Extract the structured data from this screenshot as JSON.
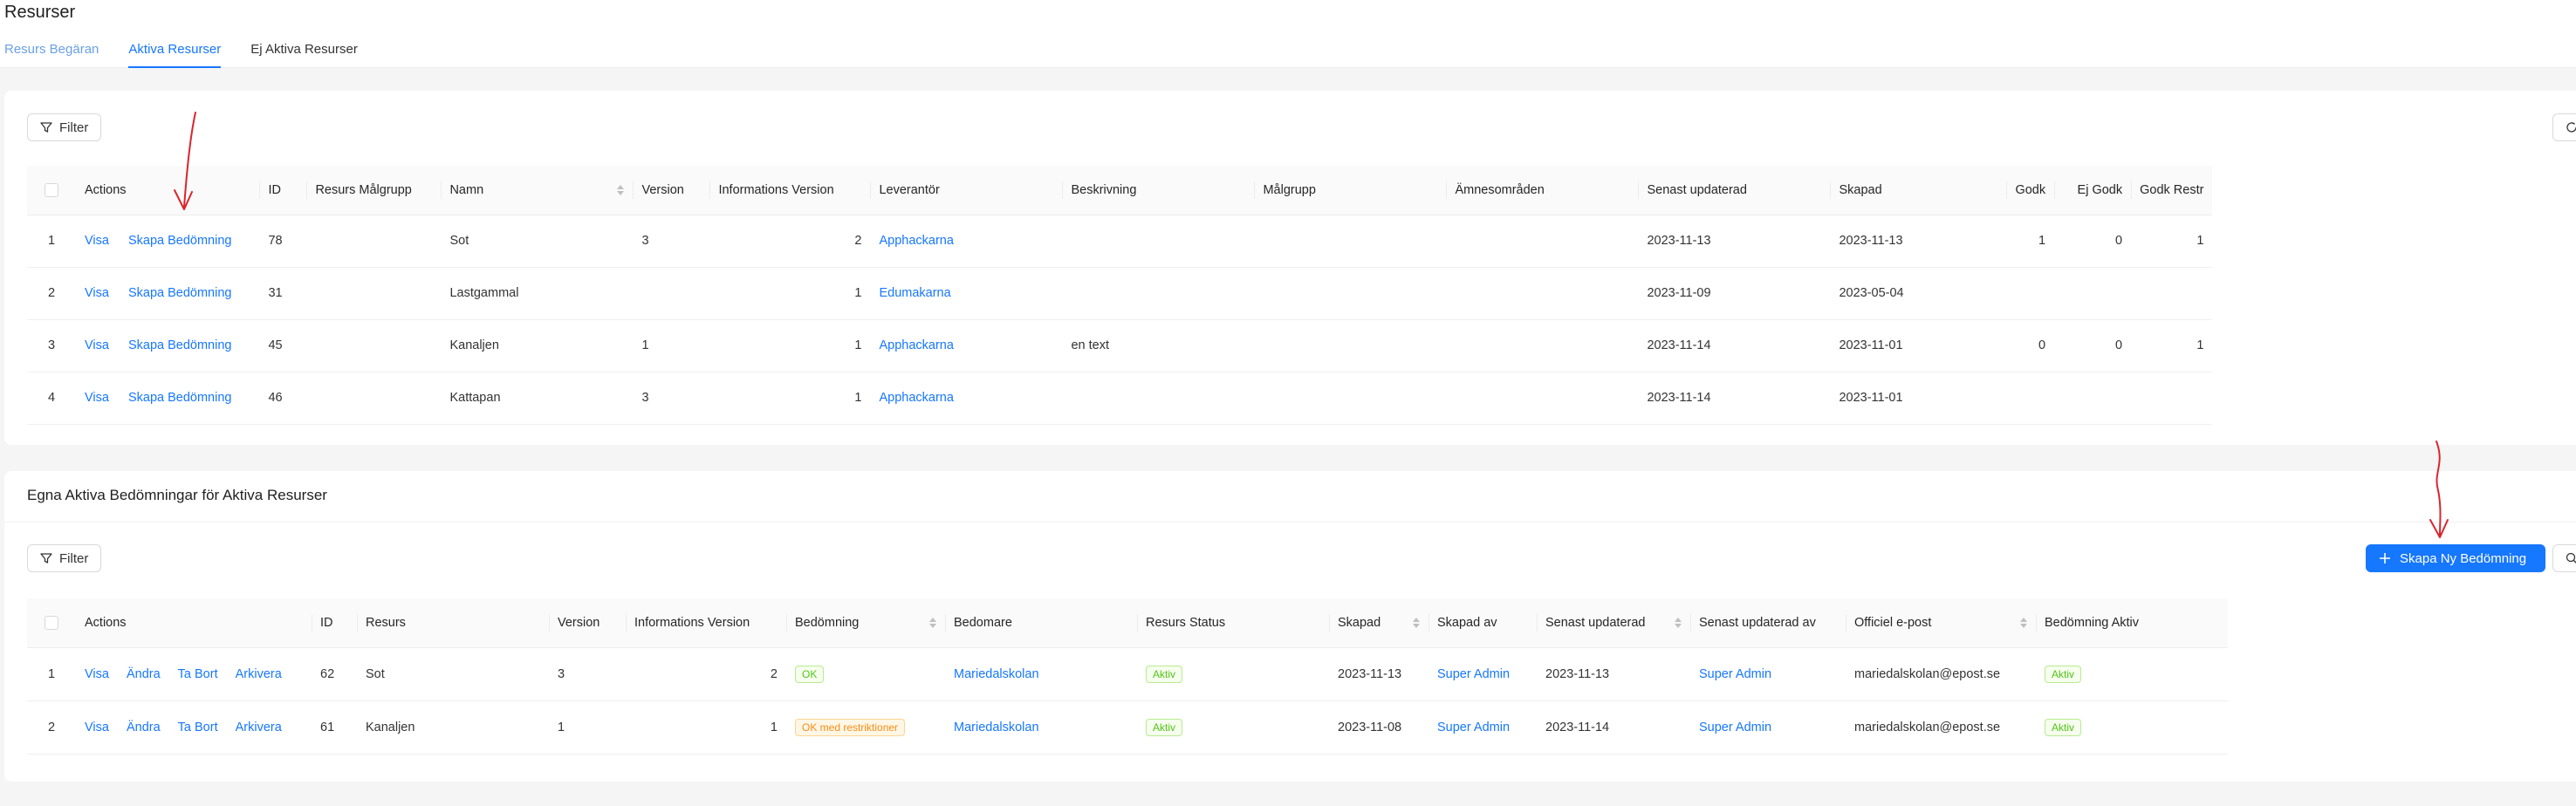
{
  "page": {
    "title": "Resurser"
  },
  "tabs": [
    {
      "label": "Resurs Begäran"
    },
    {
      "label": "Aktiva Resurser"
    },
    {
      "label": "Ej Aktiva Resurser"
    }
  ],
  "section1": {
    "filter_label": "Filter",
    "columns": [
      "Actions",
      "ID",
      "Resurs Målgrupp",
      "Namn",
      "Version",
      "Informations Version",
      "Leverantör",
      "Beskrivning",
      "Målgrupp",
      "Ämnesområden",
      "Senast updaterad",
      "Skapad",
      "Godk",
      "Ej Godk",
      "Godk Restr"
    ],
    "action_labels": {
      "view": "Visa",
      "create": "Skapa Bedömning"
    },
    "rows": [
      {
        "n": "1",
        "id": "78",
        "malgrupp_res": "",
        "namn": "Sot",
        "version": "3",
        "info_version": "2",
        "leverantor": "Apphackarna",
        "beskrivning": "",
        "malgrupp": "",
        "amnen": "",
        "updated": "2023-11-13",
        "created": "2023-11-13",
        "godk": "1",
        "ejgodk": "0",
        "restr": "1"
      },
      {
        "n": "2",
        "id": "31",
        "malgrupp_res": "",
        "namn": "Lastgammal",
        "version": "",
        "info_version": "1",
        "leverantor": "Edumakarna",
        "beskrivning": "",
        "malgrupp": "",
        "amnen": "",
        "updated": "2023-11-09",
        "created": "2023-05-04",
        "godk": "",
        "ejgodk": "",
        "restr": ""
      },
      {
        "n": "3",
        "id": "45",
        "malgrupp_res": "",
        "namn": "Kanaljen",
        "version": "1",
        "info_version": "1",
        "leverantor": "Apphackarna",
        "beskrivning": "en text",
        "malgrupp": "",
        "amnen": "",
        "updated": "2023-11-14",
        "created": "2023-11-01",
        "godk": "0",
        "ejgodk": "0",
        "restr": "1"
      },
      {
        "n": "4",
        "id": "46",
        "malgrupp_res": "",
        "namn": "Kattapan",
        "version": "3",
        "info_version": "1",
        "leverantor": "Apphackarna",
        "beskrivning": "",
        "malgrupp": "",
        "amnen": "",
        "updated": "2023-11-14",
        "created": "2023-11-01",
        "godk": "",
        "ejgodk": "",
        "restr": ""
      }
    ]
  },
  "section2": {
    "title": "Egna Aktiva Bedömningar för Aktiva Resurser",
    "filter_label": "Filter",
    "create_label": "Skapa Ny Bedömning",
    "columns": [
      "Actions",
      "ID",
      "Resurs",
      "Version",
      "Informations Version",
      "Bedömning",
      "Bedomare",
      "Resurs Status",
      "Skapad",
      "Skapad av",
      "Senast updaterad",
      "Senast updaterad av",
      "Officiel e-post",
      "Bedömning Aktiv"
    ],
    "action_labels": {
      "view": "Visa",
      "edit": "Ändra",
      "delete": "Ta Bort",
      "archive": "Arkivera"
    },
    "rows": [
      {
        "n": "1",
        "id": "62",
        "resurs": "Sot",
        "version": "3",
        "info_version": "2",
        "bedomning": "OK",
        "bedomare": "Mariedalskolan",
        "status": "Aktiv",
        "created": "2023-11-13",
        "created_by": "Super Admin",
        "updated": "2023-11-13",
        "updated_by": "Super Admin",
        "email": "mariedalskolan@epost.se",
        "active": "Aktiv"
      },
      {
        "n": "2",
        "id": "61",
        "resurs": "Kanaljen",
        "version": "1",
        "info_version": "1",
        "bedomning": "OK med restriktioner",
        "bedomare": "Mariedalskolan",
        "status": "Aktiv",
        "created": "2023-11-08",
        "created_by": "Super Admin",
        "updated": "2023-11-14",
        "updated_by": "Super Admin",
        "email": "mariedalskolan@epost.se",
        "active": "Aktiv"
      }
    ]
  },
  "colors": {
    "primary": "#1677ff",
    "success": "#52c41a",
    "warning": "#fa8c16",
    "annotation": "#d9262c"
  }
}
